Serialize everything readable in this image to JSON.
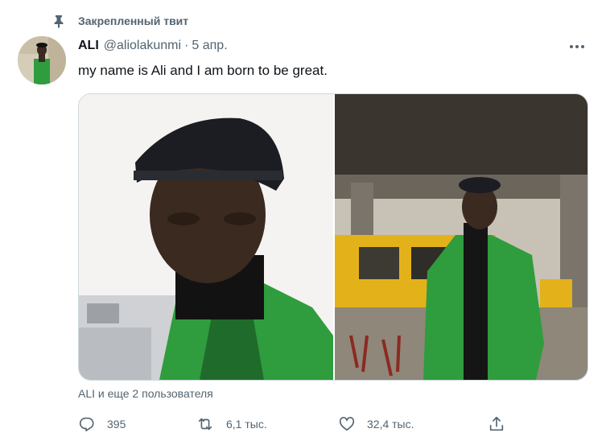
{
  "pinned": {
    "label": "Закрепленный твит",
    "icon": "pin-icon"
  },
  "author": {
    "display_name": "ALI",
    "handle": "@aliolakunmi",
    "separator": "·",
    "date": "5 апр."
  },
  "tweet": {
    "text": "my name is Ali and I am born to be great.",
    "media_count": 2
  },
  "liked_by": "ALI и еще 2 пользователя",
  "actions": {
    "reply": {
      "icon": "reply-icon",
      "count": "395"
    },
    "retweet": {
      "icon": "retweet-icon",
      "count": "6,1 тыс."
    },
    "like": {
      "icon": "heart-icon",
      "count": "32,4 тыс."
    },
    "share": {
      "icon": "share-icon"
    }
  },
  "colors": {
    "text_primary": "#0f1419",
    "text_secondary": "#536471",
    "border": "#cfd9de",
    "jacket_green": "#2f9c3e",
    "bus_yellow": "#e3b21b"
  }
}
